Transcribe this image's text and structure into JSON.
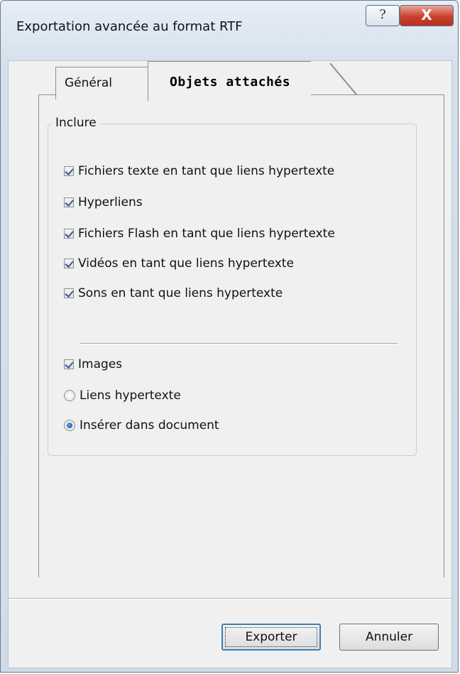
{
  "window": {
    "title": "Exportation avancée au format RTF",
    "help_symbol": "?",
    "close_symbol": "X"
  },
  "tabs": [
    {
      "label": "Général",
      "active": false
    },
    {
      "label": "Objets attachés",
      "active": true
    }
  ],
  "include_group": {
    "legend": "Inclure",
    "checkboxes": [
      {
        "label": "Fichiers texte en tant que liens hypertexte",
        "checked": true
      },
      {
        "label": "Hyperliens",
        "checked": true
      },
      {
        "label": "Fichiers Flash en tant que liens hypertexte",
        "checked": true
      },
      {
        "label": "Vidéos en tant que liens hypertexte",
        "checked": true
      },
      {
        "label": "Sons en tant que liens hypertexte",
        "checked": true
      }
    ],
    "images": {
      "label": "Images",
      "checked": true
    },
    "radios": [
      {
        "label": "Liens hypertexte",
        "selected": false
      },
      {
        "label": "Insérer dans document",
        "selected": true
      }
    ]
  },
  "buttons": {
    "export": "Exporter",
    "cancel": "Annuler"
  }
}
